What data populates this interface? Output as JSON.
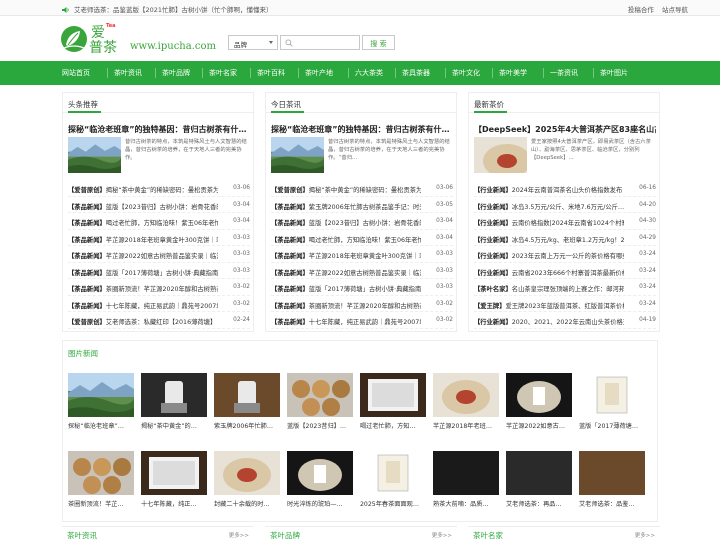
{
  "topbar": {
    "notice": "艾老师选茶：品鉴蓝版【2021忙肺】古树小饼（忙个肺啊，懂懂来）",
    "links": [
      "投稿合作",
      "站点导航"
    ]
  },
  "logo": {
    "cn_top": "爱",
    "cn_bottom": "普茶",
    "badge": "Tea",
    "url": "www.ipucha.com"
  },
  "search": {
    "select_value": "品牌",
    "placeholder": "",
    "button": "搜 索"
  },
  "nav": [
    "网站首页",
    "茶叶资讯",
    "茶叶品牌",
    "茶叶名家",
    "茶叶百科",
    "茶叶产地",
    "六大茶类",
    "茶具茶器",
    "茶叶文化",
    "茶叶美学",
    "一茶资讯",
    "茶叶图片"
  ],
  "columns": [
    {
      "title": "头条推荐",
      "feature": {
        "title": "探秘“临沧老班章”的独特基因：昔归古树茶有什…",
        "desc": "昔归古树茶的特点，本筑是特殊风土与人文智慧的结晶，昔归古树茶的培养，在于天地人三者的完美协作。"
      },
      "items": [
        {
          "tag": "【爱普原创】",
          "text": "揭秘“茶中黄金”的稀缺密码：曼松贡茶为",
          "date": "03-06"
        },
        {
          "tag": "【茶品新闻】",
          "text": "蓝版【2023昔归】古树小饼：岩骨花香的",
          "date": "03-04"
        },
        {
          "tag": "【茶品新闻】",
          "text": "喝过老忙肺，方知临沧味！紫玉06年老忙肺",
          "date": "03-04"
        },
        {
          "tag": "【茶品新闻】",
          "text": "芊芷源2018年老班章黄金叶300克饼｜乌",
          "date": "03-03"
        },
        {
          "tag": "【茶品新闻】",
          "text": "芊芷源2022如意古树熟普品鉴实录｜临沧",
          "date": "03-03"
        },
        {
          "tag": "【茶品新闻】",
          "text": "蓝版「2017薄荷塘」古树小饼·典藏指南",
          "date": "03-03"
        },
        {
          "tag": "【茶品新闻】",
          "text": "茶圈新顶流！芊芷源2020年醇和古树熟茶",
          "date": "03-02"
        },
        {
          "tag": "【茶品新闻】",
          "text": "十七年陈藏，纯正易武韵｜鼎苑号2007年",
          "date": "03-02"
        },
        {
          "tag": "【爱普原创】",
          "text": "艾老师选茶：私藏红印【2016薄荷塘】",
          "date": "02-24"
        }
      ]
    },
    {
      "title": "今日茶讯",
      "feature": {
        "title": "探秘“临沧老班章”的独特基因：昔归古树茶有什…",
        "desc": "昔归古树茶的特点，本筑是特殊风土与人文智慧的结晶，昔归古树茶的培养，在于天地人三者的完美协作。“昔归…"
      },
      "items": [
        {
          "tag": "【爱普原创】",
          "text": "揭秘“茶中黄金”的稀缺密码：曼松贡茶为",
          "date": "03-06"
        },
        {
          "tag": "【茶品新闻】",
          "text": "紫玉牌2006年忙肺古树茶品鉴手记：时光",
          "date": "03-05"
        },
        {
          "tag": "【茶品新闻】",
          "text": "蓝版【2023昔归】古树小饼：岩骨花香的",
          "date": "03-04"
        },
        {
          "tag": "【茶品新闻】",
          "text": "喝过老忙肺，方知临沧味！紫玉06年老忙肺",
          "date": "03-04"
        },
        {
          "tag": "【茶品新闻】",
          "text": "芊芷源2018年老班章黄金叶300克饼｜乌",
          "date": "03-03"
        },
        {
          "tag": "【茶品新闻】",
          "text": "芊芷源2022如意古树熟普品鉴实录｜临沧",
          "date": "03-03"
        },
        {
          "tag": "【茶品新闻】",
          "text": "蓝版「2017薄荷塘」古树小饼·典藏指南",
          "date": "03-03"
        },
        {
          "tag": "【茶品新闻】",
          "text": "茶圈新顶流！芊芷源2020年醇和古树熟茶",
          "date": "03-02"
        },
        {
          "tag": "【茶品新闻】",
          "text": "十七年陈藏，纯正易武韵｜鼎苑号2007年",
          "date": "03-02"
        }
      ]
    },
    {
      "title": "最新茶价",
      "feature": {
        "title": "【DeepSeek】2025年4大普洱茶产区83座名山古…",
        "desc": "爱王家按照4大普洱茶产区，即易武茶区（含古六茶山）、勐海茶区、思茅茶区、临沧茶区，分别列【DeepSeek】…"
      },
      "items": [
        {
          "tag": "【行业新闻】",
          "text": "2024年云南普洱茶名山头价格指数发布",
          "date": "06-16"
        },
        {
          "tag": "【行业新闻】",
          "text": "冰岛3.5万元/公斤、米地7.6万元/公斤…",
          "date": "04-20"
        },
        {
          "tag": "【行业新闻】",
          "text": "云南价格指数|2024年云南省1024个村寨",
          "date": "04-30"
        },
        {
          "tag": "【行业新闻】",
          "text": "冰岛4.5万元/kg、老班章1.2万元/kg！20",
          "date": "04-29"
        },
        {
          "tag": "【行业新闻】",
          "text": "2023年云南上万元一公斤的茶价格有哪些",
          "date": "03-24"
        },
        {
          "tag": "【行业新闻】",
          "text": "云南省2023年666个村寨普洱茶最新价格",
          "date": "03-24"
        },
        {
          "tag": "【茶叶名家】",
          "text": "名山茶皇宗理张顶端的上赛之作：邮河邦",
          "date": "03-24"
        },
        {
          "tag": "【爱王牌】",
          "text": "爱王牌2023年蓝版普洱茶、红版普洱茶价格",
          "date": "03-24"
        },
        {
          "tag": "【行业新闻】",
          "text": "2020、2021、2022年云南山头茶价格对比",
          "date": "04-19"
        }
      ]
    }
  ],
  "pictures": {
    "title": "图片新闻",
    "row1": [
      "探秘“临沧老班章”…",
      "揭秘“茶中黄金”的…",
      "紫玉牌2006年忙肺…",
      "蓝版【2023昔归】…",
      "喝过老忙肺，方知…",
      "芊芷源2018年老班…",
      "芊芷源2022如意古…",
      "蓝版「2017薄荷塘…"
    ],
    "row2": [
      "茶圈新顶流！芊芷…",
      "十七年陈藏，纯正…",
      "封藏二十余载的时…",
      "时光淬炼的琥珀—…",
      "2025年春茶面面观…",
      "熟茶大前嘀：品质…",
      "艾老师选茶：再品…",
      "艾老师选茶：品鉴…"
    ]
  },
  "bottom": [
    {
      "title": "茶叶资讯",
      "more": "更多>>"
    },
    {
      "title": "茶叶品牌",
      "more": "更多>>"
    },
    {
      "title": "茶叶名家",
      "more": "更多>>"
    }
  ]
}
